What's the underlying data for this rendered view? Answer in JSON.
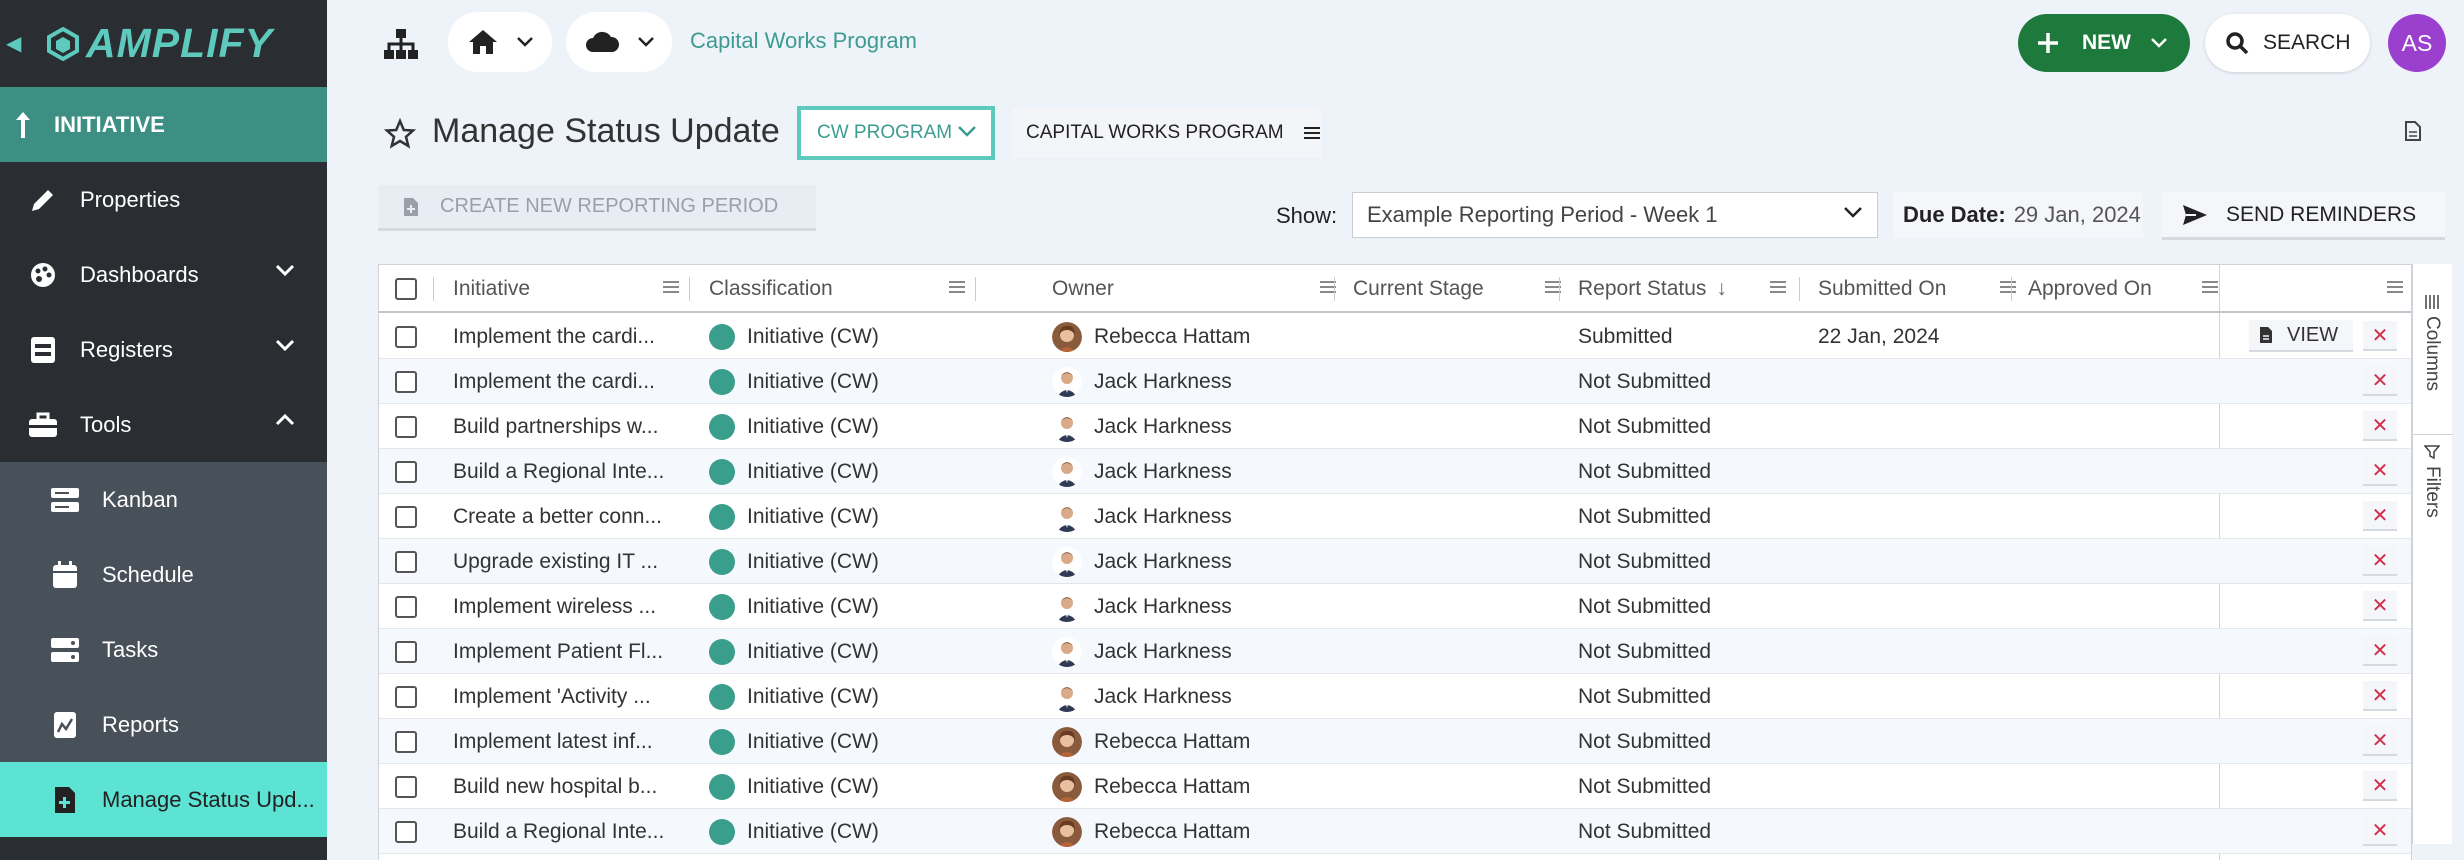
{
  "brand": {
    "name": "AMPLIFY"
  },
  "sidebar": {
    "section_label": "INITIATIVE",
    "items": [
      {
        "label": "Properties",
        "icon": "pencil-icon"
      },
      {
        "label": "Dashboards",
        "icon": "palette-icon"
      },
      {
        "label": "Registers",
        "icon": "register-icon"
      },
      {
        "label": "Tools",
        "icon": "toolbox-icon"
      }
    ],
    "sub_items": [
      {
        "label": "Kanban",
        "icon": "kanban-icon"
      },
      {
        "label": "Schedule",
        "icon": "calendar-icon"
      },
      {
        "label": "Tasks",
        "icon": "tasks-icon"
      },
      {
        "label": "Reports",
        "icon": "report-icon"
      },
      {
        "label": "Manage Status Upd...",
        "icon": "status-update-icon",
        "active": true
      }
    ]
  },
  "topbar": {
    "breadcrumb": "Capital Works Program",
    "new_label": "NEW",
    "search_label": "SEARCH",
    "avatar_initials": "AS"
  },
  "page": {
    "title": "Manage Status Update",
    "program_select": "CW PROGRAM",
    "program_name": "CAPITAL WORKS PROGRAM",
    "create_period_label": "CREATE NEW REPORTING PERIOD",
    "show_label": "Show:",
    "period_value": "Example Reporting Period - Week 1",
    "due_date_label": "Due Date:",
    "due_date_value": "29 Jan, 2024",
    "send_reminders_label": "SEND REMINDERS"
  },
  "grid": {
    "columns": [
      "Initiative",
      "Classification",
      "Owner",
      "Current Stage",
      "Report Status",
      "Submitted On",
      "Approved On"
    ],
    "sort_indicator": "↓",
    "view_label": "VIEW",
    "rows": [
      {
        "initiative": "Implement the cardi...",
        "classification": "Initiative (CW)",
        "owner": "Rebecca Hattam",
        "owner_avatar": "female",
        "stage": "",
        "status": "Submitted",
        "submitted_on": "22 Jan, 2024",
        "approved_on": "",
        "has_view": true
      },
      {
        "initiative": "Implement the cardi...",
        "classification": "Initiative (CW)",
        "owner": "Jack Harkness",
        "owner_avatar": "male",
        "stage": "",
        "status": "Not Submitted",
        "submitted_on": "",
        "approved_on": "",
        "has_view": false
      },
      {
        "initiative": "Build partnerships w...",
        "classification": "Initiative (CW)",
        "owner": "Jack Harkness",
        "owner_avatar": "male",
        "stage": "",
        "status": "Not Submitted",
        "submitted_on": "",
        "approved_on": "",
        "has_view": false
      },
      {
        "initiative": "Build a Regional Inte...",
        "classification": "Initiative (CW)",
        "owner": "Jack Harkness",
        "owner_avatar": "male",
        "stage": "",
        "status": "Not Submitted",
        "submitted_on": "",
        "approved_on": "",
        "has_view": false
      },
      {
        "initiative": "Create a better conn...",
        "classification": "Initiative (CW)",
        "owner": "Jack Harkness",
        "owner_avatar": "male",
        "stage": "",
        "status": "Not Submitted",
        "submitted_on": "",
        "approved_on": "",
        "has_view": false
      },
      {
        "initiative": "Upgrade existing IT ...",
        "classification": "Initiative (CW)",
        "owner": "Jack Harkness",
        "owner_avatar": "male",
        "stage": "",
        "status": "Not Submitted",
        "submitted_on": "",
        "approved_on": "",
        "has_view": false
      },
      {
        "initiative": "Implement wireless ...",
        "classification": "Initiative (CW)",
        "owner": "Jack Harkness",
        "owner_avatar": "male",
        "stage": "",
        "status": "Not Submitted",
        "submitted_on": "",
        "approved_on": "",
        "has_view": false
      },
      {
        "initiative": "Implement Patient Fl...",
        "classification": "Initiative (CW)",
        "owner": "Jack Harkness",
        "owner_avatar": "male",
        "stage": "",
        "status": "Not Submitted",
        "submitted_on": "",
        "approved_on": "",
        "has_view": false
      },
      {
        "initiative": "Implement 'Activity ...",
        "classification": "Initiative (CW)",
        "owner": "Jack Harkness",
        "owner_avatar": "male",
        "stage": "",
        "status": "Not Submitted",
        "submitted_on": "",
        "approved_on": "",
        "has_view": false
      },
      {
        "initiative": "Implement latest inf...",
        "classification": "Initiative (CW)",
        "owner": "Rebecca Hattam",
        "owner_avatar": "female",
        "stage": "",
        "status": "Not Submitted",
        "submitted_on": "",
        "approved_on": "",
        "has_view": false
      },
      {
        "initiative": "Build new hospital b...",
        "classification": "Initiative (CW)",
        "owner": "Rebecca Hattam",
        "owner_avatar": "female",
        "stage": "",
        "status": "Not Submitted",
        "submitted_on": "",
        "approved_on": "",
        "has_view": false
      },
      {
        "initiative": "Build a Regional Inte...",
        "classification": "Initiative (CW)",
        "owner": "Rebecca Hattam",
        "owner_avatar": "female",
        "stage": "",
        "status": "Not Submitted",
        "submitted_on": "",
        "approved_on": "",
        "has_view": false
      }
    ]
  },
  "side_panel": {
    "columns_label": "Columns",
    "filters_label": "Filters"
  },
  "colors": {
    "brand_teal": "#5ec9bd",
    "new_green": "#1e7a3c",
    "avatar_purple": "#9b3fcf",
    "active_nav": "#5ce3d4",
    "delete_red": "#d0304a"
  }
}
